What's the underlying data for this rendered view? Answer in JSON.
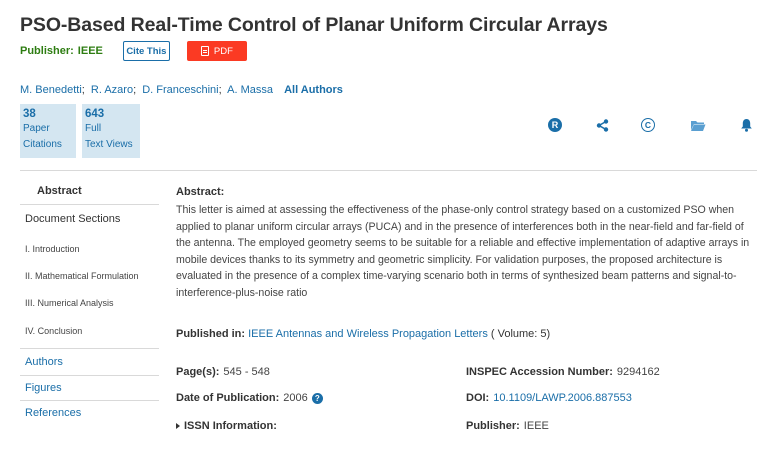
{
  "title": "PSO-Based Real-Time Control of Planar Uniform Circular Arrays",
  "publisher_row": {
    "label": "Publisher:",
    "name": "IEEE",
    "cite_button": "Cite This",
    "pdf_button": "PDF"
  },
  "authors": {
    "list": [
      "M. Benedetti",
      "R. Azaro",
      "D. Franceschini",
      "A. Massa"
    ],
    "separator": ";",
    "all_authors": "All Authors"
  },
  "metrics": [
    {
      "value": "38",
      "label1": "Paper",
      "label2": "Citations"
    },
    {
      "value": "643",
      "label1": "Full",
      "label2": "Text Views"
    }
  ],
  "action_icons": [
    "rights-permissions-icon",
    "share-icon",
    "copyright-icon",
    "folder-icon",
    "bell-icon"
  ],
  "colors": {
    "link": "#1a6ea8",
    "publisher_green": "#2e7d12",
    "pdf_red": "#fb3a23",
    "metric_bg": "#d4e6f1"
  },
  "sidebar": {
    "abstract": "Abstract",
    "document_sections": "Document Sections",
    "sections": [
      "I. Introduction",
      "II. Mathematical Formulation",
      "III. Numerical Analysis",
      "IV. Conclusion"
    ],
    "links": [
      "Authors",
      "Figures",
      "References"
    ]
  },
  "abstract": {
    "heading": "Abstract:",
    "text": "This letter is aimed at assessing the effectiveness of the phase-only control strategy based on a customized PSO when applied to planar uniform circular arrays (PUCA) and in the presence of interferences both in the near-field and far-field of the antenna. The employed geometry seems to be suitable for a reliable and effective implementation of adaptive arrays in mobile devices thanks to its symmetry and geometric simplicity. For validation purposes, the proposed architecture is evaluated in the presence of a complex time-varying scenario both in terms of synthesized beam patterns and signal-to-interference-plus-noise ratio"
  },
  "published_in": {
    "label": "Published in:",
    "journal": "IEEE Antennas and Wireless Propagation Letters",
    "volume": "( Volume: 5)"
  },
  "meta": {
    "pages_label": "Page(s):",
    "pages": "545 - 548",
    "date_label": "Date of Publication:",
    "date": "2006",
    "issn_label": "ISSN Information:",
    "inspec_label": "INSPEC Accession Number:",
    "inspec": "9294162",
    "doi_label": "DOI:",
    "doi": "10.1109/LAWP.2006.887553",
    "publisher_label": "Publisher:",
    "publisher": "IEEE"
  }
}
